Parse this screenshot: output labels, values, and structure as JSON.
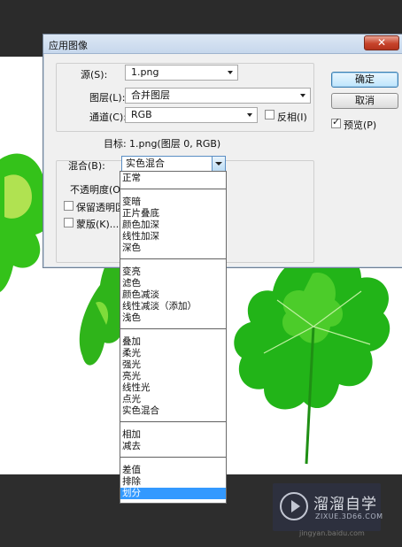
{
  "dialog": {
    "title": "应用图像",
    "close_label": "✕",
    "source_label": "源(S):",
    "source_value": "1.png",
    "layer_label": "图层(L):",
    "layer_value": "合并图层",
    "channel_label": "通道(C):",
    "channel_value": "RGB",
    "invert_label": "反相(I)",
    "invert_checked": false,
    "target_label": "目标:",
    "target_value": "1.png(图层 0, RGB)",
    "blend_label": "混合(B):",
    "blend_value": "实色混合",
    "opacity_label": "不透明度(O)",
    "preserve_label": "保留透明区",
    "mask_label": "蒙版(K)...",
    "ok_label": "确定",
    "cancel_label": "取消",
    "preview_label": "预览(P)",
    "preview_checked": true
  },
  "blend_menu": {
    "groups": [
      [
        "正常"
      ],
      [
        "变暗",
        "正片叠底",
        "颜色加深",
        "线性加深",
        "深色"
      ],
      [
        "变亮",
        "滤色",
        "颜色减淡",
        "线性减淡（添加）",
        "浅色"
      ],
      [
        "叠加",
        "柔光",
        "强光",
        "亮光",
        "线性光",
        "点光",
        "实色混合"
      ],
      [
        "相加",
        "减去"
      ],
      [
        "差值",
        "排除",
        "划分"
      ]
    ],
    "selected": "划分"
  },
  "watermark": {
    "title": "溜溜自学",
    "subtitle": "ZIXUE.3D66.COM",
    "url": "jingyan.baidu.com"
  }
}
